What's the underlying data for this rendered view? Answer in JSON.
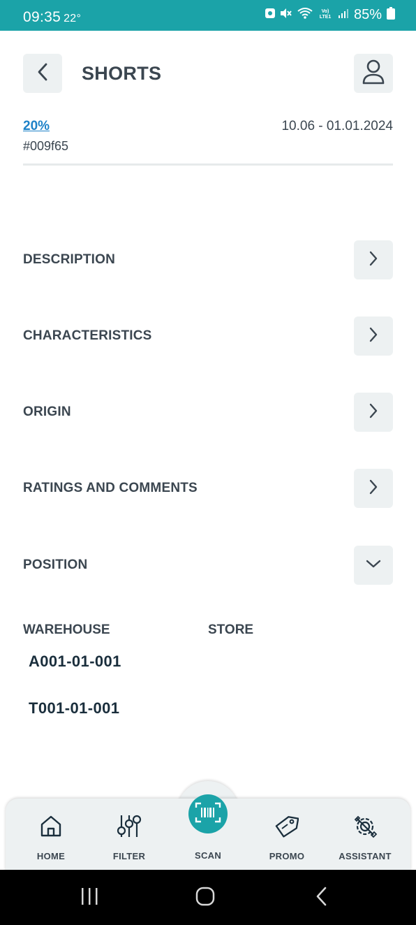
{
  "status_bar": {
    "time": "09:35",
    "temperature": "22°",
    "battery": "85%"
  },
  "header": {
    "title": "SHORTS",
    "back_icon": "chevron-left-icon",
    "user_icon": "user-icon"
  },
  "promo": {
    "percent": "20%",
    "code": "#009f65",
    "dates": "10.06 - 01.01.2024"
  },
  "sections": [
    {
      "label": "DESCRIPTION",
      "icon": "chevron-right-icon"
    },
    {
      "label": "CHARACTERISTICS",
      "icon": "chevron-right-icon"
    },
    {
      "label": "ORIGIN",
      "icon": "chevron-right-icon"
    },
    {
      "label": "RATINGS AND COMMENTS",
      "icon": "chevron-right-icon"
    },
    {
      "label": "POSITION",
      "icon": "chevron-down-icon"
    }
  ],
  "position": {
    "warehouse_label": "WAREHOUSE",
    "store_label": "STORE",
    "locations": [
      "A001-01-001",
      "T001-01-001"
    ]
  },
  "bottom_nav": {
    "items": [
      {
        "label": "HOME",
        "icon": "home-icon"
      },
      {
        "label": "FILTER",
        "icon": "filter-icon"
      },
      {
        "label": "SCAN",
        "icon": "barcode-scan-icon"
      },
      {
        "label": "PROMO",
        "icon": "tag-icon"
      },
      {
        "label": "ASSISTANT",
        "icon": "settings-assistant-icon"
      }
    ]
  },
  "colors": {
    "accent": "#1ba3a8",
    "link": "#1e82c8",
    "text": "#3b4650",
    "button_bg": "#edf1f2"
  }
}
